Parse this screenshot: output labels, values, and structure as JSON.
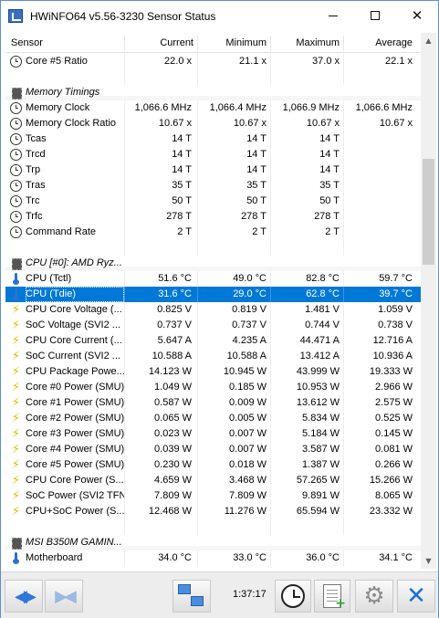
{
  "window": {
    "title": "HWiNFO64 v5.56-3230 Sensor Status"
  },
  "columns": [
    "Sensor",
    "Current",
    "Minimum",
    "Maximum",
    "Average"
  ],
  "rows": [
    {
      "icon": "clock",
      "name": "Core #5 Ratio",
      "cur": "22.0 x",
      "min": "21.1 x",
      "max": "37.0 x",
      "avg": "22.1 x"
    },
    {
      "icon": "",
      "name": "",
      "cur": "",
      "min": "",
      "max": "",
      "avg": ""
    },
    {
      "icon": "chip",
      "name": "Memory Timings",
      "group": true,
      "cur": "",
      "min": "",
      "max": "",
      "avg": ""
    },
    {
      "icon": "clock",
      "name": "Memory Clock",
      "cur": "1,066.6 MHz",
      "min": "1,066.4 MHz",
      "max": "1,066.9 MHz",
      "avg": "1,066.6 MHz"
    },
    {
      "icon": "clock",
      "name": "Memory Clock Ratio",
      "cur": "10.67 x",
      "min": "10.67 x",
      "max": "10.67 x",
      "avg": "10.67 x"
    },
    {
      "icon": "clock",
      "name": "Tcas",
      "cur": "14 T",
      "min": "14 T",
      "max": "14 T",
      "avg": ""
    },
    {
      "icon": "clock",
      "name": "Trcd",
      "cur": "14 T",
      "min": "14 T",
      "max": "14 T",
      "avg": ""
    },
    {
      "icon": "clock",
      "name": "Trp",
      "cur": "14 T",
      "min": "14 T",
      "max": "14 T",
      "avg": ""
    },
    {
      "icon": "clock",
      "name": "Tras",
      "cur": "35 T",
      "min": "35 T",
      "max": "35 T",
      "avg": ""
    },
    {
      "icon": "clock",
      "name": "Trc",
      "cur": "50 T",
      "min": "50 T",
      "max": "50 T",
      "avg": ""
    },
    {
      "icon": "clock",
      "name": "Trfc",
      "cur": "278 T",
      "min": "278 T",
      "max": "278 T",
      "avg": ""
    },
    {
      "icon": "clock",
      "name": "Command Rate",
      "cur": "2 T",
      "min": "2 T",
      "max": "2 T",
      "avg": ""
    },
    {
      "icon": "",
      "name": "",
      "cur": "",
      "min": "",
      "max": "",
      "avg": ""
    },
    {
      "icon": "chip",
      "name": "CPU [#0]: AMD Ryz...",
      "group": true,
      "cur": "",
      "min": "",
      "max": "",
      "avg": ""
    },
    {
      "icon": "therm",
      "name": "CPU (Tctl)",
      "cur": "51.6 °C",
      "min": "49.0 °C",
      "max": "82.8 °C",
      "avg": "59.7 °C"
    },
    {
      "icon": "therm",
      "name": "CPU (Tdie)",
      "selected": true,
      "cur": "31.6 °C",
      "min": "29.0 °C",
      "max": "62.8 °C",
      "avg": "39.7 °C"
    },
    {
      "icon": "bolt",
      "name": "CPU Core Voltage (...",
      "cur": "0.825 V",
      "min": "0.819 V",
      "max": "1.481 V",
      "avg": "1.059 V"
    },
    {
      "icon": "bolt",
      "name": "SoC Voltage (SVI2 ...",
      "cur": "0.737 V",
      "min": "0.737 V",
      "max": "0.744 V",
      "avg": "0.738 V"
    },
    {
      "icon": "bolt",
      "name": "CPU Core Current (...",
      "cur": "5.647 A",
      "min": "4.235 A",
      "max": "44.471 A",
      "avg": "12.716 A"
    },
    {
      "icon": "bolt",
      "name": "SoC Current (SVI2 ...",
      "cur": "10.588 A",
      "min": "10.588 A",
      "max": "13.412 A",
      "avg": "10.936 A"
    },
    {
      "icon": "bolt",
      "name": "CPU Package Powe...",
      "cur": "14.123 W",
      "min": "10.945 W",
      "max": "43.999 W",
      "avg": "19.333 W"
    },
    {
      "icon": "bolt",
      "name": "Core #0 Power (SMU)",
      "cur": "1.049 W",
      "min": "0.185 W",
      "max": "10.953 W",
      "avg": "2.966 W"
    },
    {
      "icon": "bolt",
      "name": "Core #1 Power (SMU)",
      "cur": "0.587 W",
      "min": "0.009 W",
      "max": "13.612 W",
      "avg": "2.575 W"
    },
    {
      "icon": "bolt",
      "name": "Core #2 Power (SMU)",
      "cur": "0.065 W",
      "min": "0.005 W",
      "max": "5.834 W",
      "avg": "0.525 W"
    },
    {
      "icon": "bolt",
      "name": "Core #3 Power (SMU)",
      "cur": "0.023 W",
      "min": "0.007 W",
      "max": "5.184 W",
      "avg": "0.145 W"
    },
    {
      "icon": "bolt",
      "name": "Core #4 Power (SMU)",
      "cur": "0.039 W",
      "min": "0.007 W",
      "max": "3.587 W",
      "avg": "0.081 W"
    },
    {
      "icon": "bolt",
      "name": "Core #5 Power (SMU)",
      "cur": "0.230 W",
      "min": "0.018 W",
      "max": "1.387 W",
      "avg": "0.266 W"
    },
    {
      "icon": "bolt",
      "name": "CPU Core Power (S...",
      "cur": "4.659 W",
      "min": "3.468 W",
      "max": "57.265 W",
      "avg": "15.266 W"
    },
    {
      "icon": "bolt",
      "name": "SoC Power (SVI2 TFN)",
      "cur": "7.809 W",
      "min": "7.809 W",
      "max": "9.891 W",
      "avg": "8.065 W"
    },
    {
      "icon": "bolt",
      "name": "CPU+SoC Power (S...",
      "cur": "12.468 W",
      "min": "11.276 W",
      "max": "65.594 W",
      "avg": "23.332 W"
    },
    {
      "icon": "",
      "name": "",
      "cur": "",
      "min": "",
      "max": "",
      "avg": ""
    },
    {
      "icon": "chip",
      "name": "MSI B350M GAMIN...",
      "group": true,
      "cur": "",
      "min": "",
      "max": "",
      "avg": ""
    },
    {
      "icon": "therm",
      "name": "Motherboard",
      "cur": "34.0 °C",
      "min": "33.0 °C",
      "max": "36.0 °C",
      "avg": "34.1 °C"
    }
  ],
  "toolbar": {
    "elapsed_time": "1:37:17"
  },
  "colors": {
    "selection": "#0078d7",
    "accent": "#2d77d9"
  }
}
